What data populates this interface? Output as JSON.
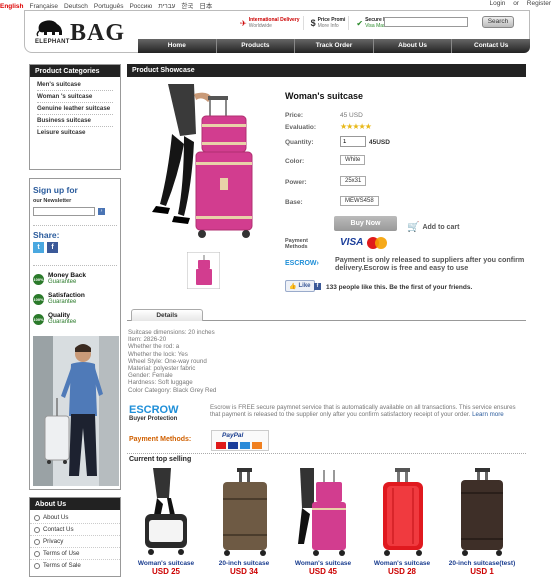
{
  "languages": [
    {
      "label": "English",
      "active": true
    },
    {
      "label": "Française"
    },
    {
      "label": "Deutsch"
    },
    {
      "label": "Português"
    },
    {
      "label": "Россию"
    },
    {
      "label": "עברית"
    },
    {
      "label": "한국"
    },
    {
      "label": "日本"
    }
  ],
  "account": {
    "login": "Login",
    "or": "or",
    "register": "Register"
  },
  "header": {
    "logo_small": "ELEPHANT",
    "logo_big": "BAG",
    "promos": [
      {
        "icon": "✈",
        "title": "International Delivery",
        "sub": "Worldwide"
      },
      {
        "icon": "$",
        "title": "Price Promi",
        "sub": "More Info"
      },
      {
        "icon": "✔",
        "title": "Secure Payment",
        "sub": "Visa MasterCard & Pa"
      }
    ],
    "search_placeholder": "",
    "search_button": "Search",
    "nav": [
      "Home",
      "Products",
      "Track Order",
      "About Us",
      "Contact Us"
    ]
  },
  "sidebar": {
    "categories_title": "Product Categories",
    "categories": [
      "Men's suitcase",
      "Woman 's suitcase",
      "Genuine leather suitcase",
      "Business suitcase",
      "Leisure suitcase"
    ],
    "signup_title": "Sign up for",
    "signup_sub": "our Newsletter",
    "share_title": "Share:",
    "guarantees": [
      {
        "title": "Money Back",
        "sub": "Guarantee"
      },
      {
        "title": "Satisfaction",
        "sub": "Guarantee"
      },
      {
        "title": "Quality",
        "sub": "Guarantee"
      }
    ],
    "about_title": "About Us",
    "about_links": [
      "About Us",
      "Contact Us",
      "Privacy",
      "Terms of Use",
      "Terms of Sale"
    ]
  },
  "main": {
    "section_title": "Product Showcase",
    "product_title": "Woman's suitcase",
    "specs": {
      "price_label": "Price:",
      "price_value": "45 USD",
      "eval_label": "Evaluatio:",
      "rating": 4.5,
      "qty_label": "Quantity:",
      "qty_value": "1",
      "qty_total": "45USD",
      "color_label": "Color:",
      "color_value": "White",
      "power_label": "Power:",
      "power_value": "25x31",
      "base_label": "Base:",
      "base_value": "MEWS458"
    },
    "buy_now": "Buy Now",
    "add_to_cart": "Add to cart",
    "payment_label": "Payment Methods",
    "escrow_text": "Payment is only released to suppliers after you confirm delivery.Escrow is free and easy to use",
    "like_label": "Like",
    "like_text": "133 people like this. Be the first of your friends.",
    "details_tab": "Details",
    "details": [
      "Suitcase dimensions: 20 inches",
      "Item: 2826-20",
      "Whether the rod: a",
      "Whether the lock: Yes",
      "Wheel Style: One-way round",
      "Material: polyester fabric",
      "Gender: Female",
      "Hardness: Soft luggage",
      "Color Category: Black Grey Red"
    ],
    "escrow_logo": "ESCROW",
    "escrow_sub": "Buyer Protection",
    "escrow_desc": "Escrow is FREE secure paymnet service that is automatically available on all transactions. This service ensures that payment is released to the supplier only after you confirm satisfactory receipt of your order.",
    "learn_more": "Learn more",
    "payment_methods_label": "Payment Methods:",
    "top_selling_title": "Current top selling",
    "top_selling": [
      {
        "name": "Woman's suitcase",
        "price": "USD 25"
      },
      {
        "name": "20-inch suitcase",
        "price": "USD 34"
      },
      {
        "name": "Woman's suitcase",
        "price": "USD 45"
      },
      {
        "name": "Woman's suitcase",
        "price": "USD 28"
      },
      {
        "name": "20-inch suitcase(test)",
        "price": "USD 1"
      }
    ]
  }
}
